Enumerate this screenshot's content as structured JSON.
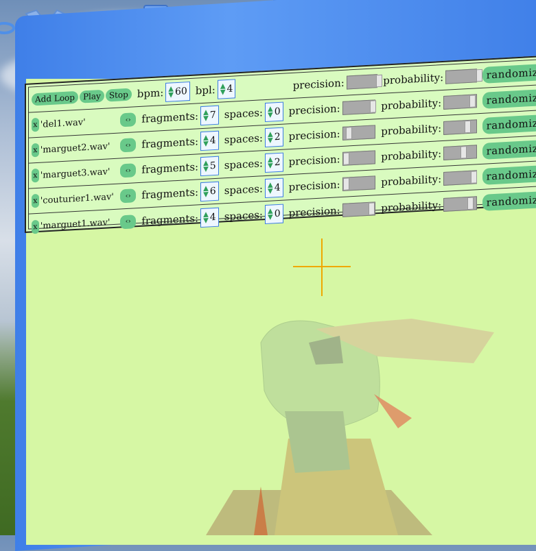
{
  "toolbar": {
    "icons": [
      "close-x-icon",
      "camera-icon",
      "down-triangle-icon",
      "down-triangle-icon-2"
    ]
  },
  "controls": {
    "add_loop": "Add Loop",
    "play": "Play",
    "stop": "Stop",
    "bpm_label": "bpm:",
    "bpm_value": "60",
    "bpl_label": "bpl:",
    "bpl_value": "4",
    "precision_label": "precision:",
    "probability_label": "probability:",
    "randomize": "randomiz"
  },
  "loops": [
    {
      "x": "x",
      "file": "'del1.wav'",
      "fragments": "7",
      "spaces": "0",
      "precision": 0.9,
      "probability": 0.85
    },
    {
      "x": "x",
      "file": "'marguet2.wav'",
      "fragments": "4",
      "spaces": "2",
      "precision": 0.1,
      "probability": 0.7
    },
    {
      "x": "x",
      "file": "'marguet3.wav'",
      "fragments": "5",
      "spaces": "2",
      "precision": 0.0,
      "probability": 0.55
    },
    {
      "x": "x",
      "file": "'couturier1.wav'",
      "fragments": "6",
      "spaces": "4",
      "precision": 0.0,
      "probability": 0.9
    },
    {
      "x": "x",
      "file": "'marguet1.wav'",
      "fragments": "4",
      "spaces": "0",
      "precision": 0.85,
      "probability": 0.8
    }
  ],
  "labels": {
    "fragments": "fragments:",
    "spaces": "spaces:"
  },
  "colors": {
    "panel_frame": "#3f7fe8",
    "panel_bg": "#d6f7a4",
    "button": "#69c98a",
    "crosshair": "#f0a800"
  }
}
